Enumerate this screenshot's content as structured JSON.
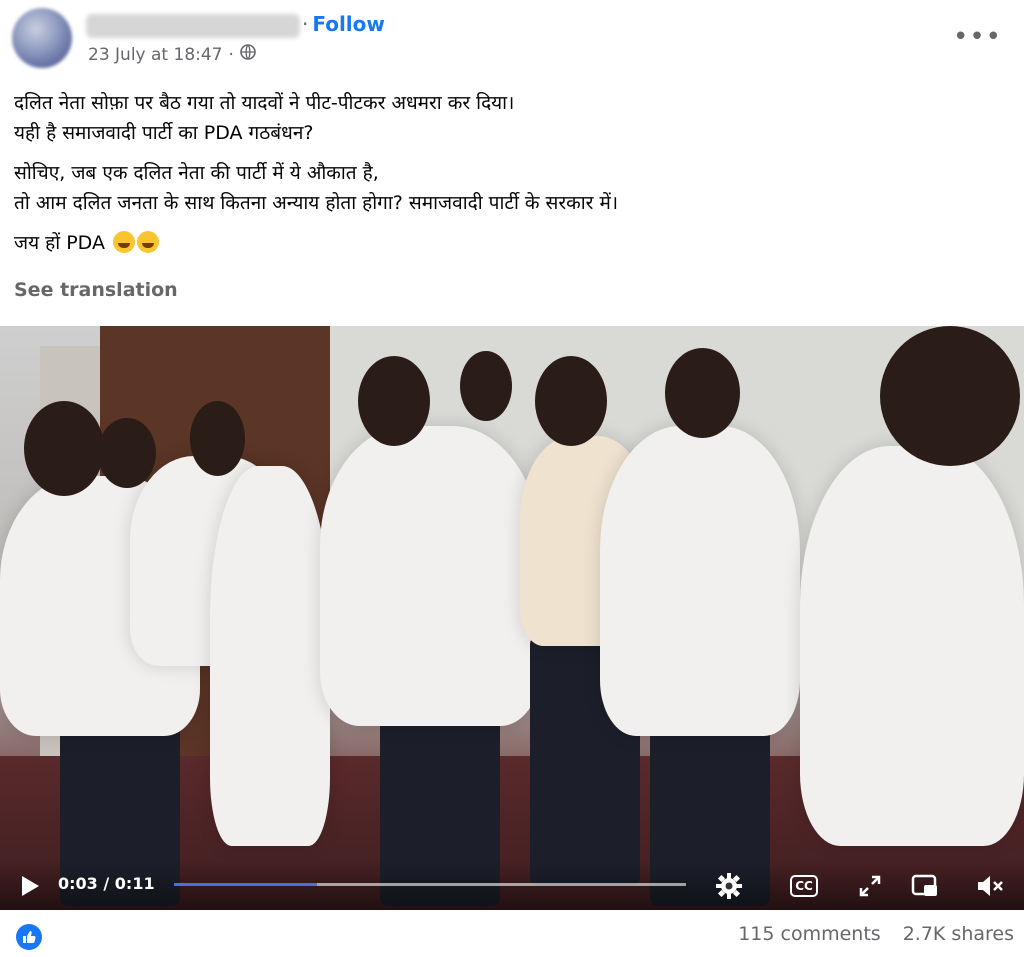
{
  "header": {
    "follow_separator": "·",
    "follow_label": "Follow",
    "timestamp": "23 July at 18:47",
    "timestamp_separator": "·",
    "audience_icon": "globe-icon",
    "more_icon": "more-options-icon",
    "more_label": "•••"
  },
  "post": {
    "paragraph1": "दलित नेता सोफ़ा पर बैठ गया तो यादवों ने पीट-पीटकर अधमरा कर दिया।\nयही है समाजवादी पार्टी का PDA गठबंधन?",
    "paragraph2": "सोचिए, जब एक दलित नेता की पार्टी में ये औकात है,\nतो आम दलित जनता के साथ कितना अन्याय होता होगा? समाजवादी पार्टी के सरकार में।",
    "paragraph3": "जय हों PDA",
    "emojis": [
      "winking-tongue-emoji",
      "tears-of-joy-emoji"
    ],
    "see_translation": "See translation"
  },
  "video": {
    "current_time": "0:03",
    "time_separator": "/",
    "duration": "0:11",
    "progress": 0.28,
    "accent_color": "#4a6ee0",
    "icons": [
      "play-icon",
      "settings-icon",
      "captions-icon",
      "fullscreen-icon",
      "picture-in-picture-icon",
      "volume-muted-icon"
    ],
    "cc_label": "CC"
  },
  "footer": {
    "reaction_icon": "like-icon",
    "comments": "115 comments",
    "shares": "2.7K shares"
  },
  "colors": {
    "link": "#1877f2",
    "secondary_text": "#65676b"
  }
}
